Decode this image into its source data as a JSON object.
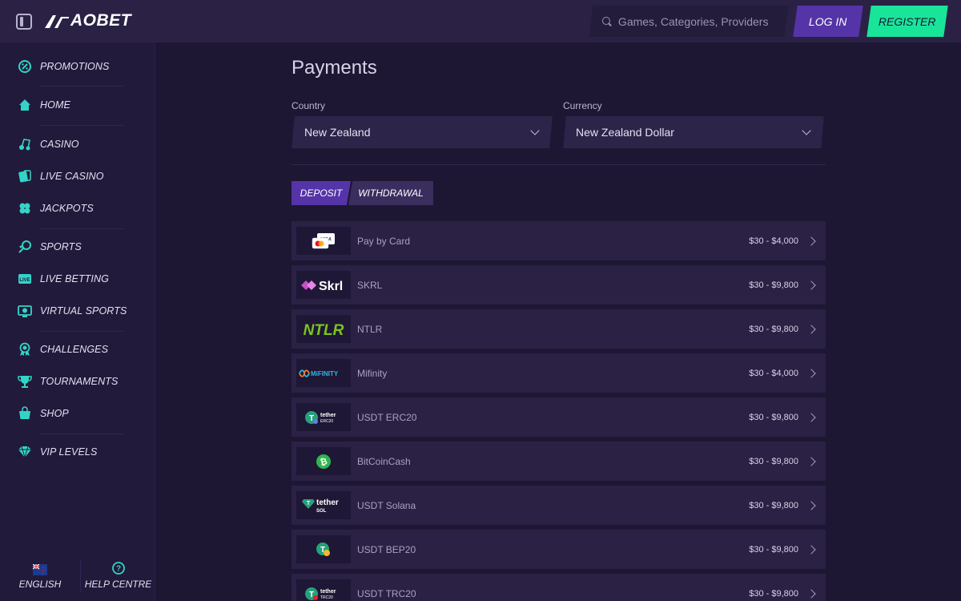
{
  "header": {
    "brand": "AOBET",
    "search_placeholder": "Games, Categories, Providers",
    "login_label": "LOG IN",
    "register_label": "REGISTER"
  },
  "sidebar": {
    "items": [
      {
        "label": "PROMOTIONS",
        "icon": "promotions-icon"
      },
      {
        "label": "HOME",
        "icon": "home-icon"
      },
      {
        "label": "CASINO",
        "icon": "casino-icon"
      },
      {
        "label": "LIVE CASINO",
        "icon": "live-casino-icon"
      },
      {
        "label": "JACKPOTS",
        "icon": "jackpots-icon"
      },
      {
        "label": "SPORTS",
        "icon": "sports-icon"
      },
      {
        "label": "LIVE BETTING",
        "icon": "live-betting-icon"
      },
      {
        "label": "VIRTUAL SPORTS",
        "icon": "virtual-sports-icon"
      },
      {
        "label": "CHALLENGES",
        "icon": "challenges-icon"
      },
      {
        "label": "TOURNAMENTS",
        "icon": "trophy-icon"
      },
      {
        "label": "SHOP",
        "icon": "shop-icon"
      },
      {
        "label": "VIP LEVELS",
        "icon": "diamond-icon"
      }
    ],
    "footer": {
      "language_label": "ENGLISH",
      "help_label": "HELP CENTRE"
    }
  },
  "main": {
    "title": "Payments",
    "country": {
      "label": "Country",
      "value": "New Zealand"
    },
    "currency": {
      "label": "Currency",
      "value": "New Zealand Dollar"
    },
    "tabs": [
      {
        "label": "DEPOSIT",
        "active": true
      },
      {
        "label": "WITHDRAWAL",
        "active": false
      }
    ],
    "methods": [
      {
        "name": "Pay by Card",
        "range": "$30 - $4,000",
        "logo": "VISA"
      },
      {
        "name": "SKRL",
        "range": "$30 - $9,800",
        "logo": "Skrl"
      },
      {
        "name": "NTLR",
        "range": "$30 - $9,800",
        "logo": "NTLR"
      },
      {
        "name": "Mifinity",
        "range": "$30 - $4,000",
        "logo": "MiFINITY"
      },
      {
        "name": "USDT ERC20",
        "range": "$30 - $9,800",
        "logo": "tether",
        "logo_sub": "ERC20"
      },
      {
        "name": "BitCoinCash",
        "range": "$30 - $9,800",
        "logo": "bitcoincash"
      },
      {
        "name": "USDT Solana",
        "range": "$30 - $9,800",
        "logo": "tether",
        "logo_sub": "SOL"
      },
      {
        "name": "USDT BEP20",
        "range": "$30 - $9,800",
        "logo": "usdt-bep20"
      },
      {
        "name": "USDT TRC20",
        "range": "$30 - $9,800",
        "logo": "tether",
        "logo_sub": "TRC20"
      }
    ]
  },
  "colors": {
    "accent_purple": "#5534a8",
    "accent_green": "#19e59a",
    "icon_teal": "#33d4c7",
    "background": "#1d1733"
  }
}
